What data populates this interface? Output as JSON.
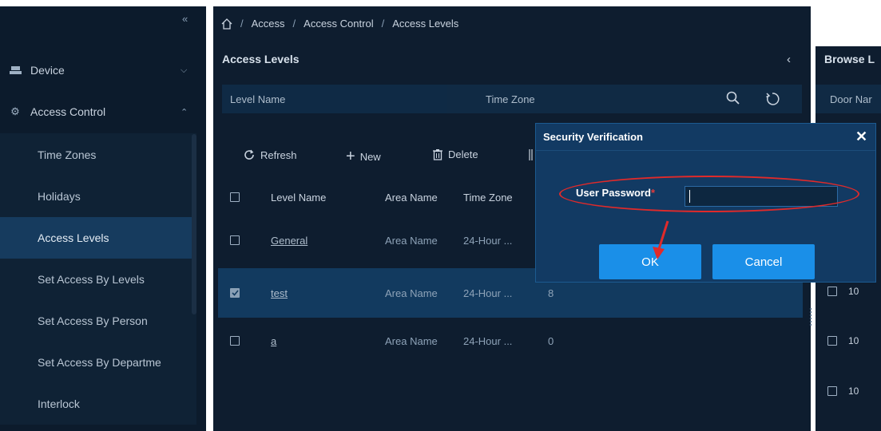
{
  "breadcrumb": [
    "Access",
    "Access Control",
    "Access Levels"
  ],
  "sidebar": {
    "groups": [
      {
        "label": "Device",
        "icon": "device-icon"
      },
      {
        "label": "Access Control",
        "icon": "gear-icon"
      }
    ],
    "items": [
      {
        "label": "Time Zones"
      },
      {
        "label": "Holidays"
      },
      {
        "label": "Access Levels",
        "active": true
      },
      {
        "label": "Set Access By Levels"
      },
      {
        "label": "Set Access By Person"
      },
      {
        "label": "Set Access By Departme"
      },
      {
        "label": "Interlock"
      }
    ]
  },
  "panel": {
    "title": "Access Levels",
    "search": {
      "level_name": "Level Name",
      "time_zone": "Time Zone"
    },
    "toolbar": {
      "refresh": "Refresh",
      "new": "New",
      "delete": "Delete"
    },
    "columns": {
      "level_name": "Level Name",
      "area_name": "Area Name",
      "time_zone": "Time Zone"
    },
    "rows": [
      {
        "level_name": "General",
        "area_name": "Area Name",
        "time_zone": "24-Hour ...",
        "count": "",
        "checked": false
      },
      {
        "level_name": "test",
        "area_name": "Area Name",
        "time_zone": "24-Hour ...",
        "count": "8",
        "checked": true
      },
      {
        "level_name": "a",
        "area_name": "Area Name",
        "time_zone": "24-Hour ...",
        "count": "0",
        "checked": false
      }
    ]
  },
  "right_panel": {
    "title": "Browse L",
    "search_label": "Door Nar",
    "rows": [
      "10",
      "10",
      "10"
    ]
  },
  "modal": {
    "title": "Security Verification",
    "password_label": "User Password",
    "required_mark": "*",
    "password_value": "",
    "ok_label": "OK",
    "cancel_label": "Cancel"
  },
  "colors": {
    "sidebar_bg": "#0c1b2c",
    "main_bg": "#0e1d2f",
    "active_item": "#163b5e",
    "modal_bg": "#123a63",
    "button_blue": "#1a8fe8",
    "highlight_red": "#e02a2a"
  }
}
